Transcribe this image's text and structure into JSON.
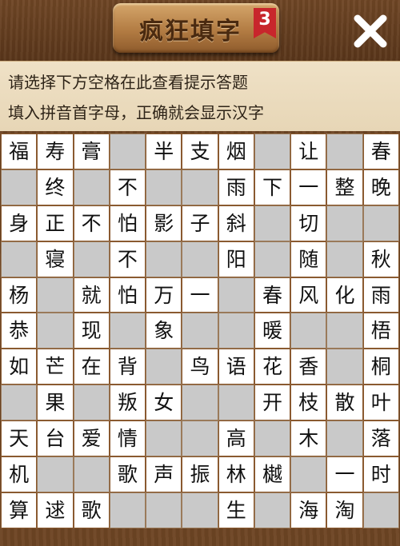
{
  "header": {
    "title": "疯狂填字",
    "level": "3"
  },
  "hints": {
    "line1": "请选择下方空格在此查看提示答题",
    "line2": "填入拼音首字母，正确就会显示汉字"
  },
  "grid": [
    [
      "福",
      "寿",
      "膏",
      "",
      "半",
      "支",
      "烟",
      "",
      "让",
      "",
      "春"
    ],
    [
      "",
      "终",
      "",
      "不",
      "",
      "",
      "雨",
      "下",
      "一",
      "整",
      "晚"
    ],
    [
      "身",
      "正",
      "不",
      "怕",
      "影",
      "子",
      "斜",
      "",
      "切",
      "",
      ""
    ],
    [
      "",
      "寝",
      "",
      "不",
      "",
      "",
      "阳",
      "",
      "随",
      "",
      "秋"
    ],
    [
      "杨",
      "",
      "就",
      "怕",
      "万",
      "一",
      "",
      "春",
      "风",
      "化",
      "雨"
    ],
    [
      "恭",
      "",
      "现",
      "",
      "象",
      "",
      "",
      "暖",
      "",
      "",
      "梧"
    ],
    [
      "如",
      "芒",
      "在",
      "背",
      "",
      "鸟",
      "语",
      "花",
      "香",
      "",
      "桐"
    ],
    [
      "",
      "果",
      "",
      "叛",
      "女",
      "",
      "",
      "开",
      "枝",
      "散",
      "叶"
    ],
    [
      "天",
      "台",
      "爱",
      "情",
      "",
      "",
      "高",
      "",
      "木",
      "",
      "落"
    ],
    [
      "机",
      "",
      "",
      "歌",
      "声",
      "振",
      "林",
      "樾",
      "",
      "一",
      "时"
    ],
    [
      "算",
      "逑",
      "歌",
      "",
      "",
      "",
      "生",
      "",
      "海",
      "淘",
      ""
    ]
  ]
}
